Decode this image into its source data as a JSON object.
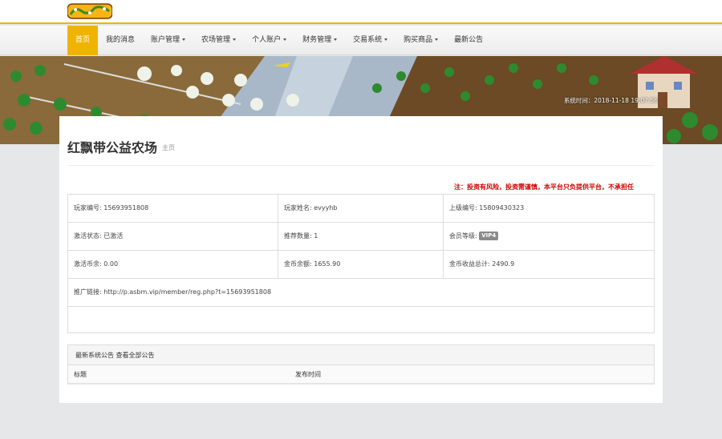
{
  "brand": {
    "logo_text": "环球农场"
  },
  "nav": {
    "items": [
      {
        "label": "首页",
        "dropdown": false,
        "active": true
      },
      {
        "label": "我的消息",
        "dropdown": false
      },
      {
        "label": "账户管理",
        "dropdown": true
      },
      {
        "label": "农场管理",
        "dropdown": true
      },
      {
        "label": "个人账户",
        "dropdown": true
      },
      {
        "label": "财务管理",
        "dropdown": true
      },
      {
        "label": "交易系统",
        "dropdown": true
      },
      {
        "label": "购买商品",
        "dropdown": true
      },
      {
        "label": "最新公告",
        "dropdown": false
      }
    ]
  },
  "banner": {
    "system_time": "系统时间：2018-11-18 19:07:56"
  },
  "page": {
    "title": "红飘带公益农场",
    "subtitle": "主页",
    "notice": "注：投资有风险，投资需谨慎，本平台只负提供平台，不承担任"
  },
  "info": {
    "row1": [
      "玩家编号: 15693951808",
      "玩家姓名: evyyhb",
      "上级编号: 15809430323"
    ],
    "row2": [
      "激活状态: 已激活",
      "推荐数量: 1",
      "会员等级:"
    ],
    "vip_badge": "VIP4",
    "row3": [
      "激活币余: 0.00",
      "金币余额: 1655.90",
      "金币收益总计: 2490.9"
    ],
    "referral": "推广链接: http://p.asbm.vip/member/reg.php?t=15693951808"
  },
  "announcements": {
    "header": "最新系统公告 查看全部公告",
    "columns": [
      "标题",
      "发布时间"
    ]
  },
  "colors": {
    "accent": "#f0b400",
    "notice": "#d00000",
    "vip_badge": "#8a8a8a"
  }
}
